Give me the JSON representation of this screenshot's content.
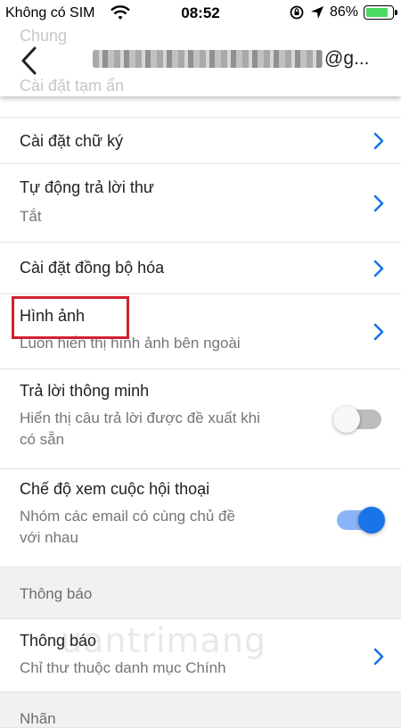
{
  "status_bar": {
    "carrier": "Không có SIM",
    "time": "08:52",
    "battery": "86%"
  },
  "header": {
    "ghost_top": "Chung",
    "ghost_bottom": "Cài đặt tạm ẩn",
    "account_domain": "@g..."
  },
  "rows": {
    "signature": {
      "title": "Cài đặt chữ ký"
    },
    "vacation": {
      "title": "Tự động trả lời thư",
      "subtitle": "Tắt"
    },
    "sync": {
      "title": "Cài đặt đồng bộ hóa"
    },
    "images": {
      "title": "Hình ảnh",
      "subtitle": "Luôn hiển thị hình ảnh bên ngoài"
    },
    "smart_reply": {
      "title": "Trả lời thông minh",
      "subtitle_line1": "Hiển thị câu trả lời được đề xuất khi",
      "subtitle_line2": "có sẵn",
      "enabled": false
    },
    "conversation_view": {
      "title": "Chế độ xem cuộc hội thoại",
      "subtitle_line1": "Nhóm các email có cùng chủ đề",
      "subtitle_line2": "với nhau",
      "enabled": true
    }
  },
  "sections": {
    "notifications_header": "Thông báo",
    "labels_header": "Nhãn"
  },
  "notifications": {
    "title": "Thông báo",
    "subtitle": "Chỉ thư thuộc danh mục Chính"
  },
  "watermark": "uantrimang",
  "colors": {
    "accent": "#1a73e8",
    "highlight": "#d0202d",
    "section_bg": "#f1f1f1"
  }
}
